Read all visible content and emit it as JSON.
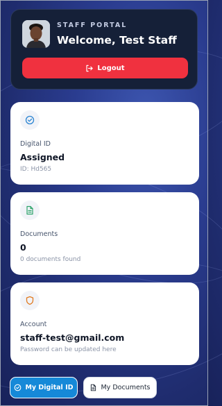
{
  "header": {
    "portal_label": "STAFF PORTAL",
    "welcome": "Welcome, Test Staff",
    "logout_label": "Logout"
  },
  "cards": [
    {
      "icon": "check-circle-icon",
      "label": "Digital ID",
      "value": "Assigned",
      "sub": "ID: Hd565",
      "icon_color": "#2a84d2"
    },
    {
      "icon": "document-icon",
      "label": "Documents",
      "value": "0",
      "sub": "0 documents found",
      "icon_color": "#2ea36a"
    },
    {
      "icon": "shield-icon",
      "label": "Account",
      "value": "staff-test@gmail.com",
      "sub": "Password can be updated here",
      "icon_color": "#e07a1f"
    }
  ],
  "nav": {
    "digital_id_label": "My Digital ID",
    "documents_label": "My Documents"
  },
  "colors": {
    "logout": "#f0313f",
    "primary": "#1689d8",
    "header_bg": "#152038"
  }
}
